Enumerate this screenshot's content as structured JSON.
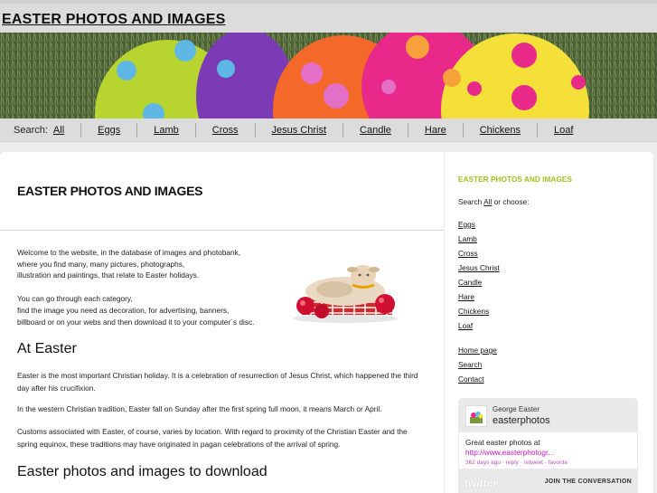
{
  "header": {
    "title": "EASTER PHOTOS AND IMAGES"
  },
  "banner": {
    "icon": "easter-eggs-photo"
  },
  "nav": {
    "label": "Search:",
    "items": [
      "All",
      "Eggs",
      "Lamb",
      "Cross",
      "Jesus Christ",
      "Candle",
      "Hare",
      "Chickens",
      "Loaf"
    ]
  },
  "main": {
    "title": "EASTER PHOTOS AND IMAGES",
    "intro_p1": [
      "Welcome to the website, in the database of images and photobank,",
      "where you find many, many pictures, photographs,",
      "illustration and paintings, that relate to Easter holidays."
    ],
    "intro_p2": [
      "You can go through each category,",
      "find the image you need as decoration, for advertising, banners,",
      "billboard or on your webs and then download it to your computer´s disc."
    ],
    "lamb_image": "lamb-figurine-image",
    "section1_heading": "At Easter",
    "section1_p1": "Easter is the most important Christian holiday. It is a celebration of resurrection of Jesus Christ, which happened the third day after his crucifixion.",
    "section1_p2": "In the western Christian tradition, Easter fall on Sunday after the first spring full moon, it means March or April.",
    "section1_p3": "Customs associated with Easter, of course, varies by location. With regard to proximity of the Christian Easter and the spring equinox, these traditions may have originated in pagan celebrations of the arrival of spring.",
    "section2_heading": "Easter photos and images to download"
  },
  "sidebar": {
    "title": "EASTER PHOTOS AND IMAGES",
    "intro_pre": "Search ",
    "intro_link": "All",
    "intro_post": " or choose:",
    "categories": [
      "Eggs",
      "Lamb",
      "Cross",
      "Jesus Christ",
      "Candle",
      "Hare",
      "Chickens",
      "Loaf"
    ],
    "pages": [
      "Home page",
      "Search",
      "Contact"
    ]
  },
  "twitter": {
    "name": "George Easter",
    "handle": "easterphotos",
    "text": "Great easter photos at",
    "link": "http://www.easterphotogr...",
    "meta": "362 days ago · reply · retweet · favorite",
    "logo": "twitter",
    "join": "JOIN THE CONVERSATION"
  },
  "colors": {
    "accent": "#9cc21b",
    "link_pink": "#c217c2"
  }
}
